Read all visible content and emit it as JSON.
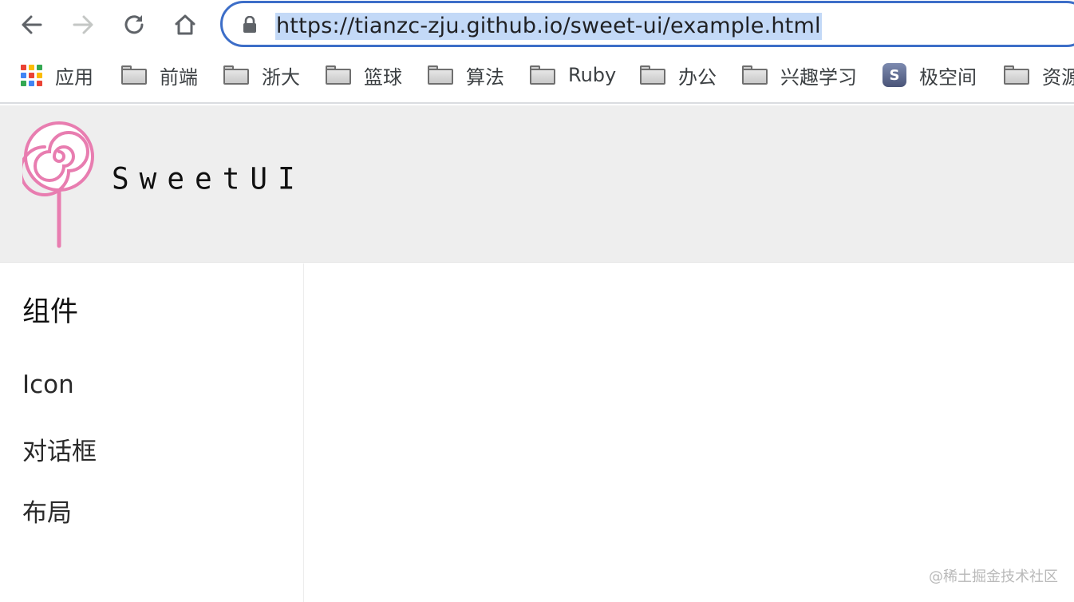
{
  "browser": {
    "url": "https://tianzc-zju.github.io/sweet-ui/example.html",
    "accent_color": "#3d6ec8",
    "bookmarks": [
      {
        "label": "应用",
        "icon": "apps-grid-icon"
      },
      {
        "label": "前端",
        "icon": "folder-icon"
      },
      {
        "label": "浙大",
        "icon": "folder-icon"
      },
      {
        "label": "篮球",
        "icon": "folder-icon"
      },
      {
        "label": "算法",
        "icon": "folder-icon"
      },
      {
        "label": "Ruby",
        "icon": "folder-icon"
      },
      {
        "label": "办公",
        "icon": "folder-icon"
      },
      {
        "label": "兴趣学习",
        "icon": "folder-icon"
      },
      {
        "label": "极空间",
        "icon": "app-icon"
      },
      {
        "label": "资源",
        "icon": "folder-icon"
      }
    ]
  },
  "header": {
    "brand": "SweetUI",
    "logo_color": "#e87db0",
    "background": "#eeeeee"
  },
  "sidebar": {
    "title": "组件",
    "items": [
      {
        "label": "Icon"
      },
      {
        "label": "对话框"
      },
      {
        "label": "布局"
      }
    ]
  },
  "watermark": "@稀土掘金技术社区"
}
